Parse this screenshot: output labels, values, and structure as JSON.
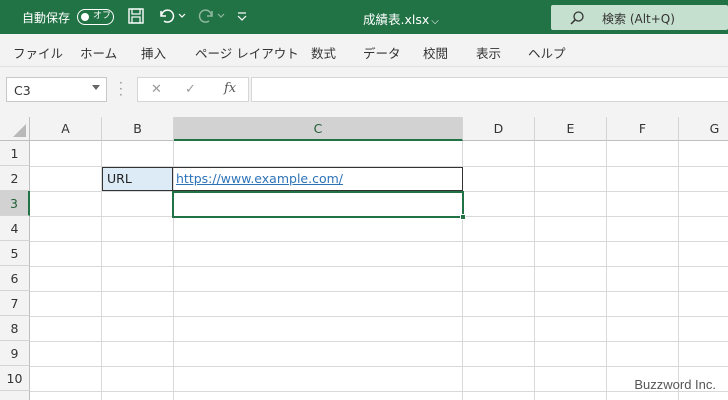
{
  "titlebar": {
    "autosave_label": "自動保存",
    "toggle_label": "オフ",
    "file_title": "成績表.xlsx",
    "search_label": "検索 (Alt+Q)"
  },
  "ribbon": {
    "tabs": [
      "ファイル",
      "ホーム",
      "挿入",
      "ページ レイアウト",
      "数式",
      "データ",
      "校閲",
      "表示",
      "ヘルプ"
    ]
  },
  "formula_bar": {
    "name_box": "C3",
    "fx_label": "fx",
    "formula": ""
  },
  "sheet": {
    "columns": [
      "A",
      "B",
      "C",
      "D",
      "E",
      "F",
      "G"
    ],
    "rows": [
      "1",
      "2",
      "3",
      "4",
      "5",
      "6",
      "7",
      "8",
      "9",
      "10"
    ],
    "selected_column": "C",
    "selected_row": "3",
    "cells": {
      "B2": "URL",
      "C2": "https://www.example.com/"
    }
  },
  "watermark": "Buzzword Inc.",
  "colors": {
    "excel_green": "#217346",
    "search_bg": "#c6e0cf",
    "b2_fill": "#ddebf7",
    "hyperlink": "#2e73b8"
  }
}
